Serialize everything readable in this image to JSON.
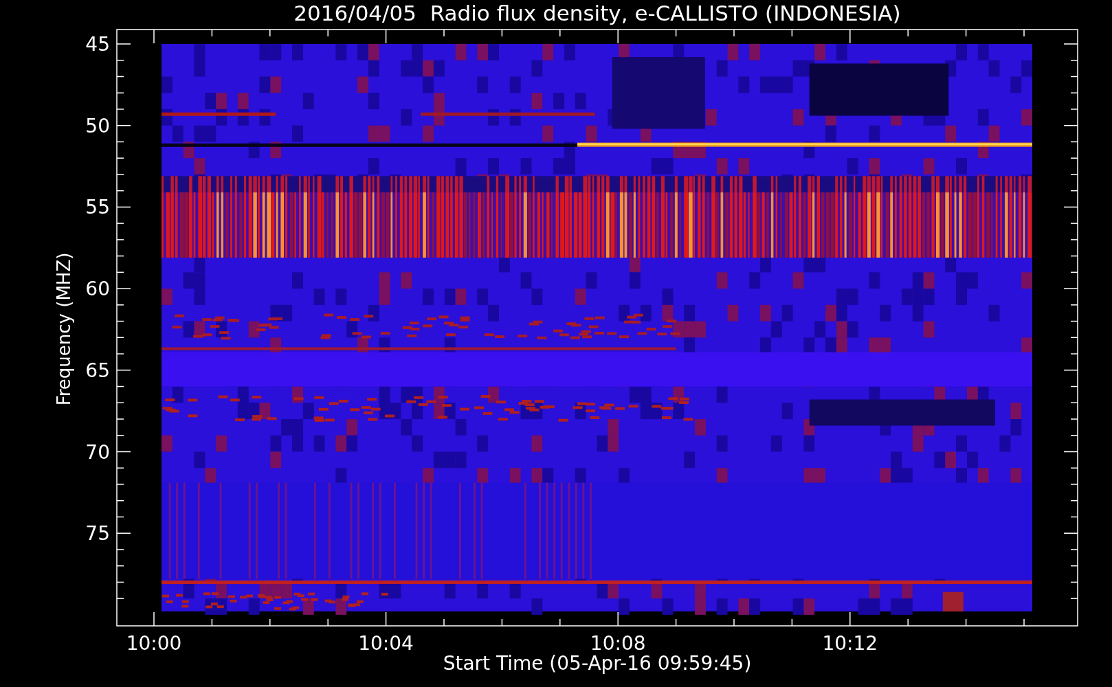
{
  "title": "2016/04/05  Radio flux density, e-CALLISTO (INDONESIA)",
  "y_axis": {
    "label": "Frequency (MHZ)",
    "ticks": [
      "45",
      "50",
      "55",
      "60",
      "65",
      "70",
      "75"
    ]
  },
  "x_axis": {
    "label": "Start Time (05-Apr-16 09:59:45)",
    "ticks": [
      "10:00",
      "10:04",
      "10:08",
      "10:12"
    ]
  }
}
